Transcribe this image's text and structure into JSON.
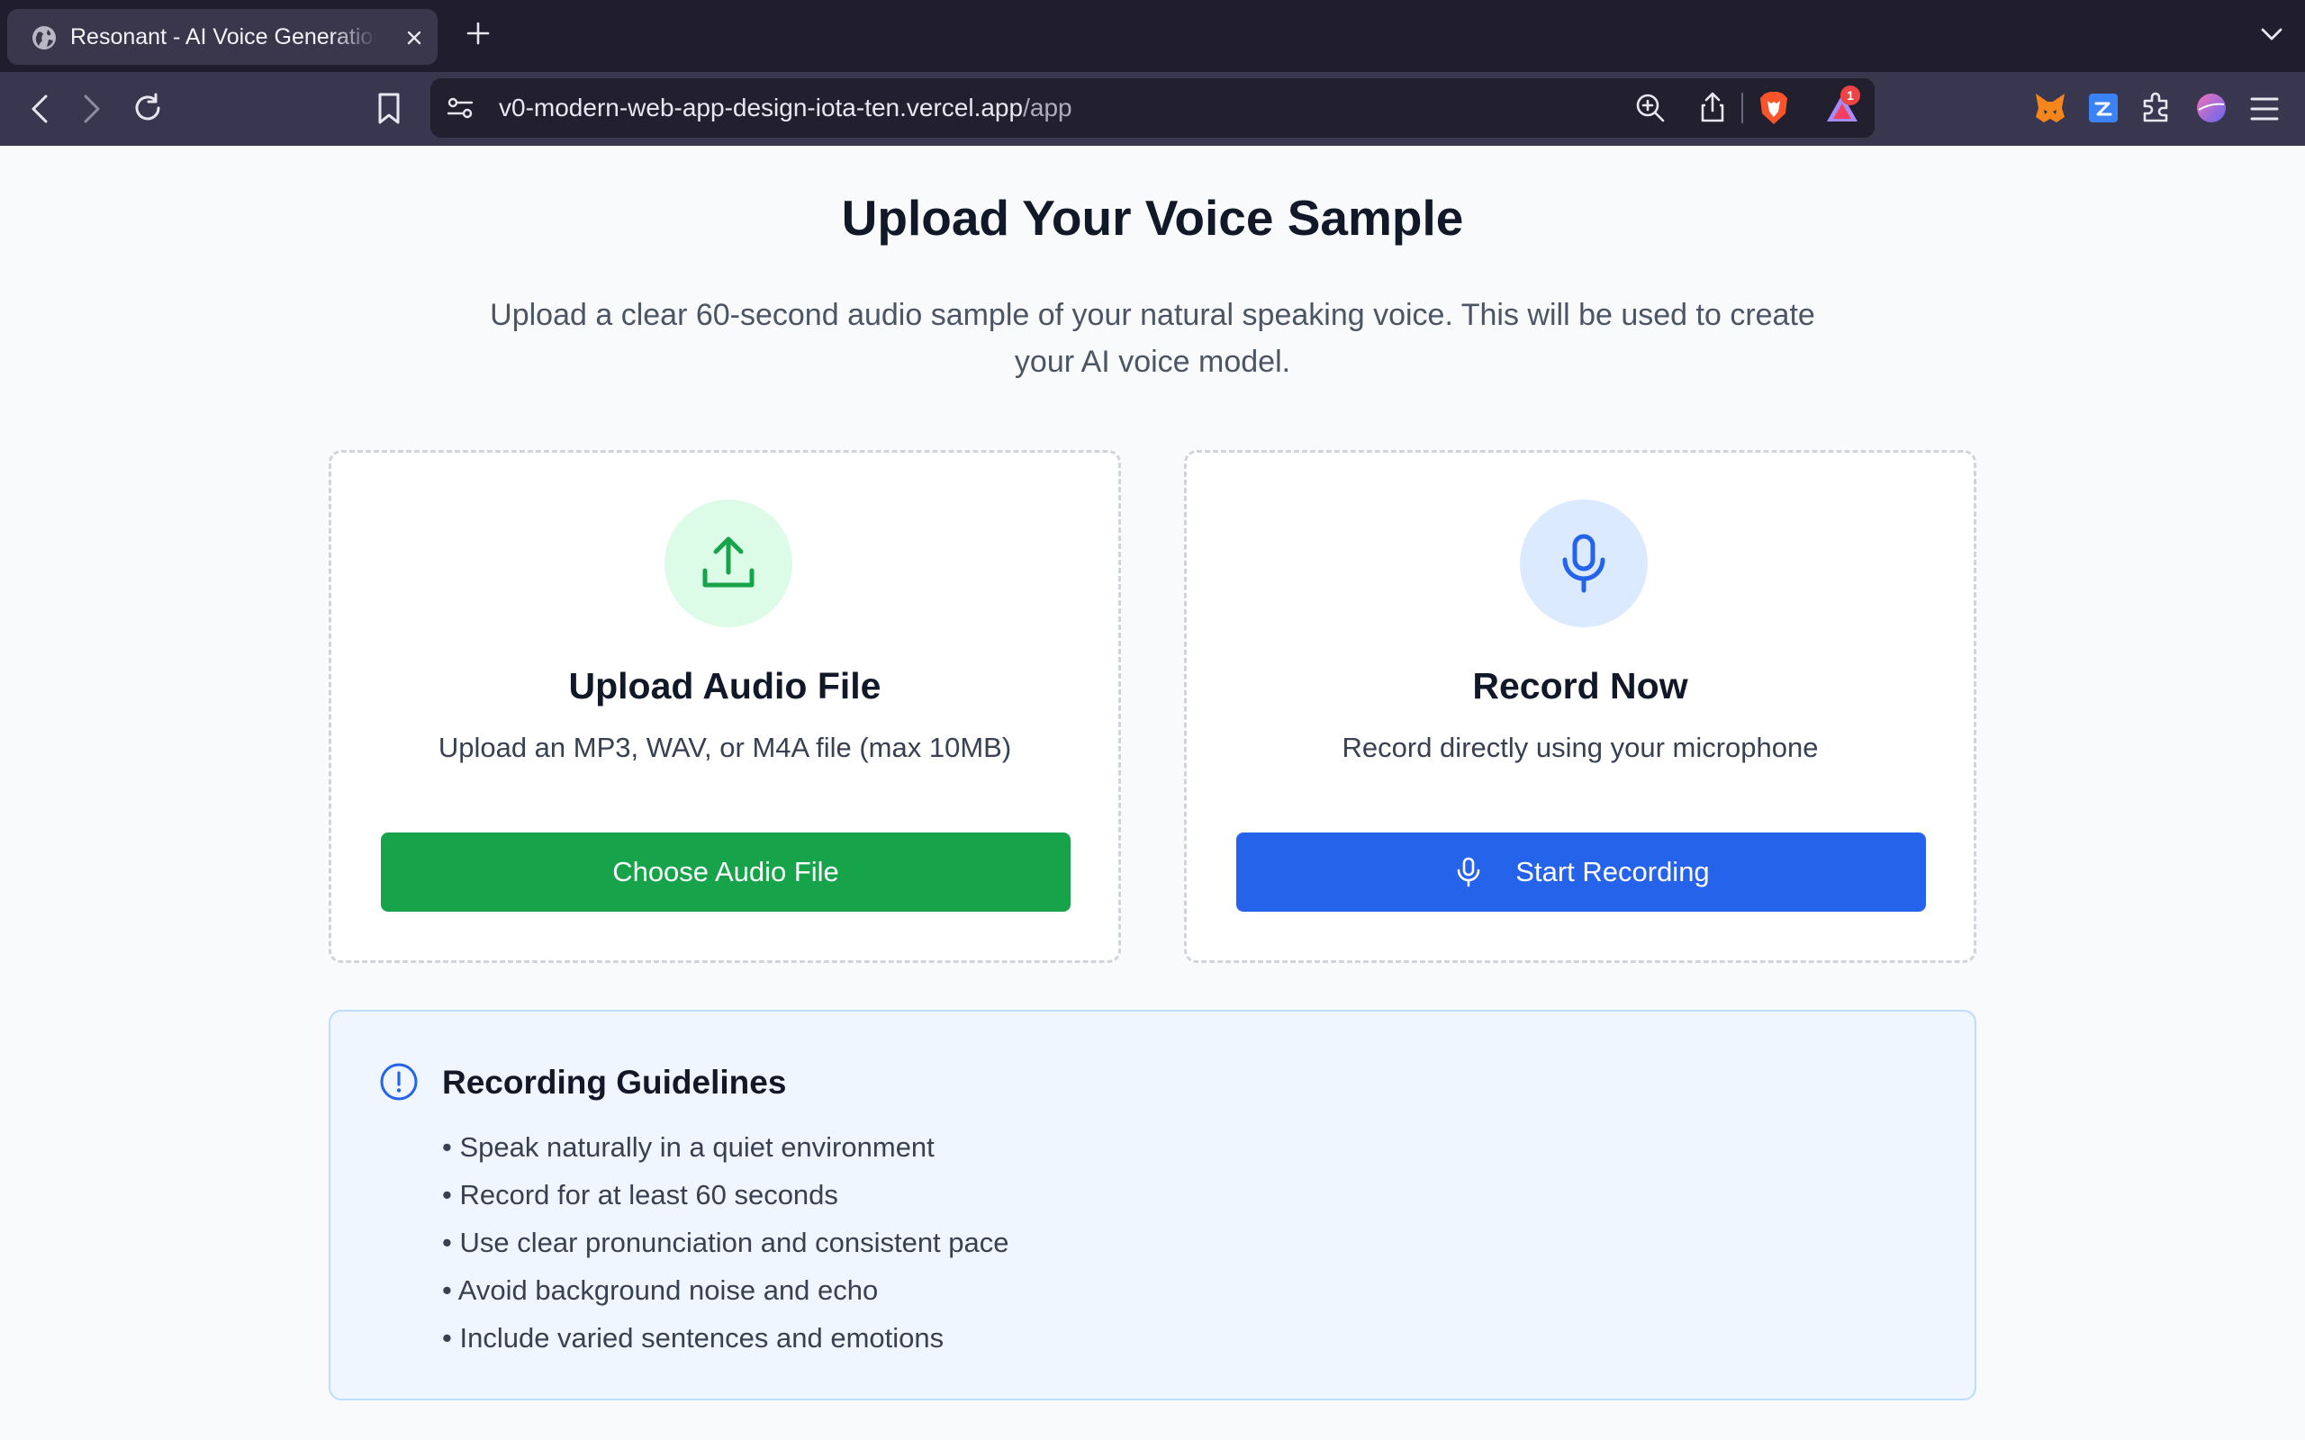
{
  "browser": {
    "tab_title": "Resonant - AI Voice Generation",
    "url_host": "v0-modern-web-app-design-iota-ten.vercel.app",
    "url_path": "/app",
    "notification_count": "1"
  },
  "page": {
    "title": "Upload Your Voice Sample",
    "subtitle": "Upload a clear 60-second audio sample of your natural speaking voice. This will be used to create your AI voice model."
  },
  "upload_card": {
    "title": "Upload Audio File",
    "description": "Upload an MP3, WAV, or M4A file (max 10MB)",
    "button_label": "Choose Audio File",
    "icon": "upload-icon",
    "accent": "#16a34a"
  },
  "record_card": {
    "title": "Record Now",
    "description": "Record directly using your microphone",
    "button_label": "Start Recording",
    "icon": "microphone-icon",
    "accent": "#2563eb"
  },
  "guidelines": {
    "title": "Recording Guidelines",
    "items": [
      "• Speak naturally in a quiet environment",
      "• Record for at least 60 seconds",
      "• Use clear pronunciation and consistent pace",
      "• Avoid background noise and echo",
      "• Include varied sentences and emotions"
    ]
  }
}
